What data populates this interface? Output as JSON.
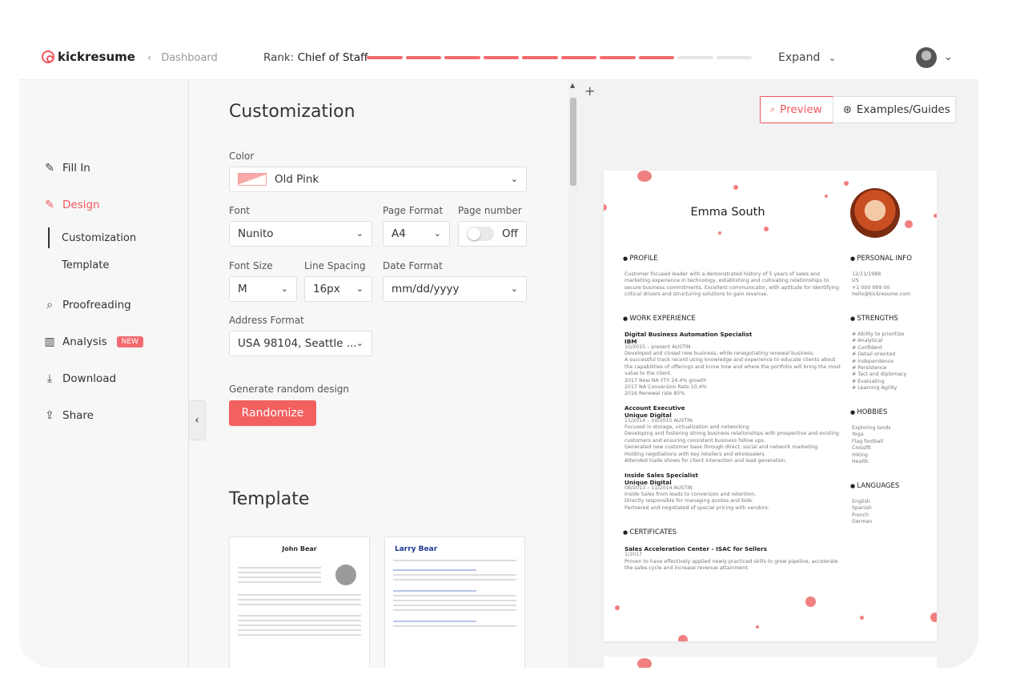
{
  "topbar": {
    "logo": "kickresume",
    "back_label": "Dashboard",
    "rank_prefix": "Rank:",
    "rank_value": "Chief of Staff",
    "rank_progress": 0.8,
    "expand_label": "Expand"
  },
  "sidebar": {
    "items": [
      {
        "label": "Fill In",
        "icon": "edit-icon"
      },
      {
        "label": "Design",
        "icon": "edit-icon"
      },
      {
        "label": "Proofreading",
        "icon": "search-doc-icon"
      },
      {
        "label": "Analysis",
        "icon": "bar-chart-icon",
        "badge": "NEW"
      },
      {
        "label": "Download",
        "icon": "download-icon"
      },
      {
        "label": "Share",
        "icon": "share-icon"
      }
    ],
    "subitems": [
      "Customization",
      "Template"
    ]
  },
  "customization": {
    "title": "Customization",
    "color_label": "Color",
    "color_value": "Old Pink",
    "font_label": "Font",
    "font_value": "Nunito",
    "page_format_label": "Page Format",
    "page_format_value": "A4",
    "page_number_label": "Page number",
    "page_number_value": "Off",
    "font_size_label": "Font Size",
    "font_size_value": "M",
    "line_spacing_label": "Line Spacing",
    "line_spacing_value": "16px",
    "date_format_label": "Date Format",
    "date_format_value": "mm/dd/yyyy",
    "address_format_label": "Address Format",
    "address_format_value": "USA 98104, Seattle ...",
    "random_label": "Generate random design",
    "randomize_button": "Randomize",
    "template_title": "Template",
    "templates": [
      "John Bear",
      "Larry Bear"
    ]
  },
  "preview": {
    "preview_button": "Preview",
    "examples_button": "Examples/Guides",
    "accent": "#f0807f",
    "resume": {
      "name": "Emma South",
      "profile_heading": "PROFILE",
      "profile_text": "Customer focused leader with a demonstrated history of 5 years of sales and marketing experience in technology, establishing and cultivating relationships to secure business commitments. Excellent communicator, with aptitude for identifying critical drivers and structuring solutions to gain revenue.",
      "work_heading": "WORK EXPERIENCE",
      "job1_title": "Digital Business Automation Specialist",
      "job1_company": "IBM",
      "job1_dates": "10/2015 – present  AUSTIN",
      "job1_b1": "Developed and closed new business, while renegotiating renewal business.",
      "job1_b2": "A successful track record using knowledge and experience to educate clients about the capabilities of offerings and know how and where the portfolio will bring the most value to the client.",
      "job1_b3": "2017 New NA YTY 24.4% growth",
      "job1_b4": "2017 NA Conversion Rate 10.4%",
      "job1_b5": "2016 Renewal rate 85%",
      "job2_title": "Account Executive",
      "job2_company": "Unique Digital",
      "job2_dates": "11/2014 – 10/2015  AUSTIN",
      "job2_b1": "Focused in storage, virtualization and networking",
      "job2_b2": "Developing and fostering strong business relationships with prospective and existing customers and ensuring consistent business follow ups.",
      "job2_b3": "Generated new customer base through direct, social and network marketing",
      "job2_b4": "Holding negotiations with key retailers and wholesalers.",
      "job2_b5": "Attended trade shows for client interaction and lead generation.",
      "job3_title": "Inside Sales Specialist",
      "job3_company": "Unique Digital",
      "job3_dates": "08/2013 – 11/2014  AUSTIN",
      "job3_b1": "Inside Sales from leads to conversion and retention.",
      "job3_b2": "Directly responsible for managing quotes and bids.",
      "job3_b3": "Partnered and negotiated of special pricing with vendors.",
      "cert_heading": "CERTIFICATES",
      "cert_title": "Sales Acceleration Center - ISAC for Sellers",
      "cert_date": "1/2017",
      "cert_text": "Proven to have effectively applied newly practiced skills to grow pipeline, accelerate the sales cycle and increase revenue attainment.",
      "info_heading": "PERSONAL INFO",
      "info_birth": "12/11/1988",
      "info_country": "US",
      "info_phone": "+1 000 999 00",
      "info_email": "hello@kickresume.com",
      "strengths_heading": "STRENGTHS",
      "strengths": [
        "# Ability to prioritize",
        "# Analytical",
        "# Confident",
        "# Detail oriented",
        "# Independence",
        "# Persistence",
        "# Tact and diplomacy",
        "# Evaluating",
        "# Learning Agility"
      ],
      "hobbies_heading": "HOBBIES",
      "hobbies": [
        "Exploring lands",
        "Yoga",
        "Flag football",
        "Crossfit",
        "Hiking",
        "Health"
      ],
      "languages_heading": "LANGUAGES",
      "languages": [
        "English",
        "Spanish",
        "French",
        "German"
      ]
    }
  }
}
